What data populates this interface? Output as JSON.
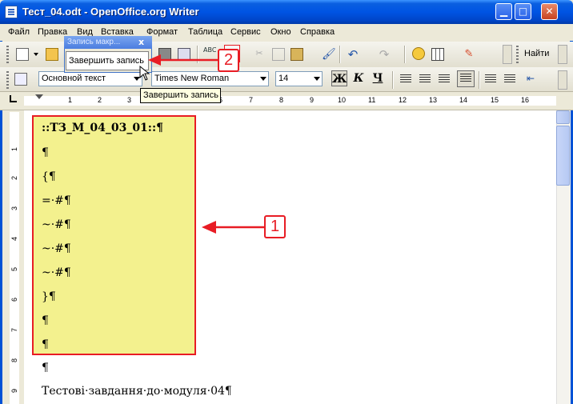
{
  "window": {
    "title": "Тест_04.odt - OpenOffice.org Writer"
  },
  "menu": [
    "Файл",
    "Правка",
    "Вид",
    "Вставка",
    "Формат",
    "Таблица",
    "Сервис",
    "Окно",
    "Справка"
  ],
  "toolbar": {
    "find_label": "Найти"
  },
  "formatting": {
    "paragraph_style": "Основной текст",
    "font_name": "Times New Roman",
    "font_size": "14",
    "bold_label": "Ж",
    "italic_label": "К",
    "underline_label": "Ч"
  },
  "ruler": {
    "marks": [
      "1",
      "1",
      "2",
      "3",
      "4",
      "5",
      "6",
      "7",
      "8",
      "9",
      "10",
      "11",
      "12",
      "13",
      "14",
      "15",
      "16"
    ]
  },
  "vruler": {
    "marks": [
      "1",
      "1",
      "2",
      "3",
      "4",
      "5",
      "6",
      "7",
      "8",
      "9"
    ]
  },
  "macro_toolbar": {
    "title": "Запись макр...",
    "close_glyph": "x",
    "stop_label": "Завершить запись"
  },
  "tooltip": "Завершить запись",
  "document": {
    "lines": [
      "::ТЗ_М_04_03_01::¶",
      "¶",
      "{¶",
      "=·#¶",
      "~·#¶",
      "~·#¶",
      "~·#¶",
      "}¶",
      "¶",
      "¶",
      "¶",
      "Тестові·завдання·до·модуля·04¶"
    ]
  },
  "callouts": {
    "one": "1",
    "two": "2"
  },
  "colors": {
    "highlight": "#f3f18e",
    "callout_red": "#e81c24",
    "titlebar_blue": "#0054e3"
  }
}
